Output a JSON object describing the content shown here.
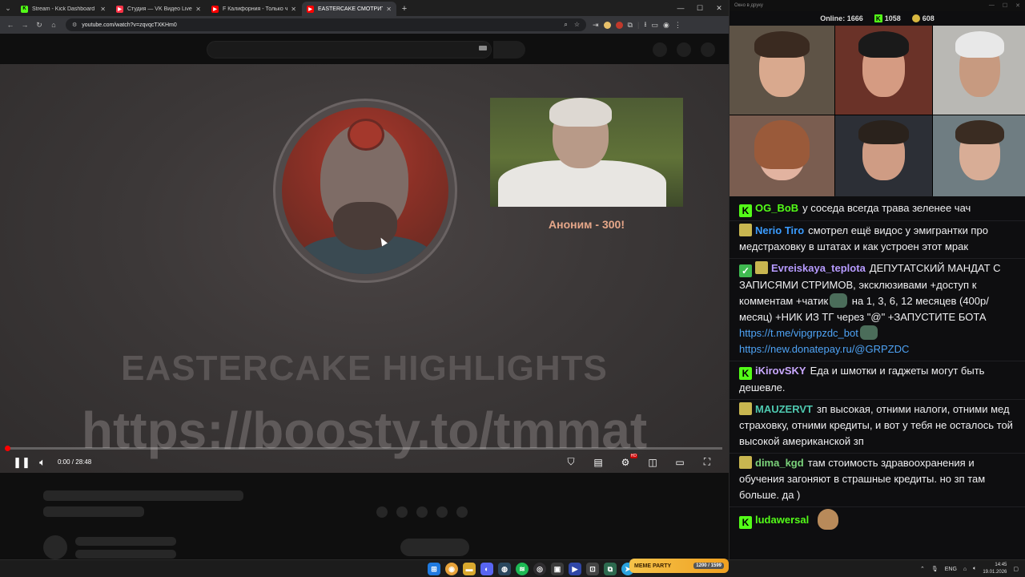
{
  "browser": {
    "tabs": [
      {
        "title": "Stream - Kick Dashboard",
        "icon": "kick-icon",
        "color": "#53fc18",
        "glyph": "K"
      },
      {
        "title": "Студия — VK Видео Live",
        "icon": "vk-video-icon",
        "color": "#ff3347",
        "glyph": "▶"
      },
      {
        "title": "F Калифорния - Только что пр",
        "icon": "youtube-icon",
        "color": "#ff0000",
        "glyph": "▶"
      },
      {
        "title": "EASTERCAKE СМОТРИТ В ДУ",
        "icon": "youtube-icon",
        "color": "#ff0000",
        "glyph": "▶"
      }
    ],
    "url": "youtube.com/watch?v=zqvqcTXKHm0"
  },
  "video": {
    "clip_caption": "Аноним - 300!",
    "overlay_title": "EASTERCAKE HIGHLIGHTS",
    "overlay_url": "https://boosty.to/tmmat",
    "time_display": "0:00 / 28:48",
    "progress": 0.004
  },
  "chat": {
    "window_title": "Окно в друку",
    "online_label": "Online:",
    "online_count": "1666",
    "kick_count": "1058",
    "coin_count": "608",
    "messages": [
      {
        "badges": [
          "kick"
        ],
        "user": "OG_BoB",
        "color": "#53fc18",
        "text": "у соседа всегда трава зеленее чач"
      },
      {
        "badges": [
          "sub"
        ],
        "user": "Nerio Tiro",
        "color": "#3b9cff",
        "text": "смотрел ещё видос у эмигрантки про медстраховку в штатах и как устроен этот мрак"
      },
      {
        "badges": [
          "check",
          "sub"
        ],
        "user": "Evreiskaya_teplota",
        "color": "#b79bff",
        "text": "ДЕПУТАТСКИЙ МАНДАТ С ЗАПИСЯМИ СТРИМОВ, эксклюзивами +доступ к комментам +чатик",
        "text2": "на 1, 3, 6, 12 месяцев (400р/месяц) +НИК ИЗ ТГ через \"@\" +ЗАПУСТИТЕ БОТА",
        "link1": "https://t.me/vipgrpzdc_bot",
        "link2": "https://new.donatepay.ru/@GRPZDC"
      },
      {
        "badges": [
          "kick"
        ],
        "user": "iKirovSKY",
        "color": "#c9a8ff",
        "text": "Еда и шмотки и гаджеты могут быть дешевле."
      },
      {
        "badges": [
          "sub"
        ],
        "user": "MAUZERVT",
        "color": "#4ec9b0",
        "text": "зп высокая, отними налоги, отними мед страховку, отними кредиты, и вот у тебя не осталось той высокой американской зп"
      },
      {
        "badges": [
          "sub"
        ],
        "user": "dima_kgd",
        "color": "#7bd37b",
        "text": "там стоимость здравоохранения и обучения загоняют в страшные кредиты. но зп там больше. да )"
      },
      {
        "badges": [
          "kick"
        ],
        "user": "ludawersal",
        "color": "#53fc18",
        "text": ""
      }
    ]
  },
  "taskbar": {
    "meme_label": "MEME PARTY",
    "meme_count": "1200 / 1599",
    "lang": "ENG",
    "time": "14:45",
    "date": "19.01.2026"
  }
}
